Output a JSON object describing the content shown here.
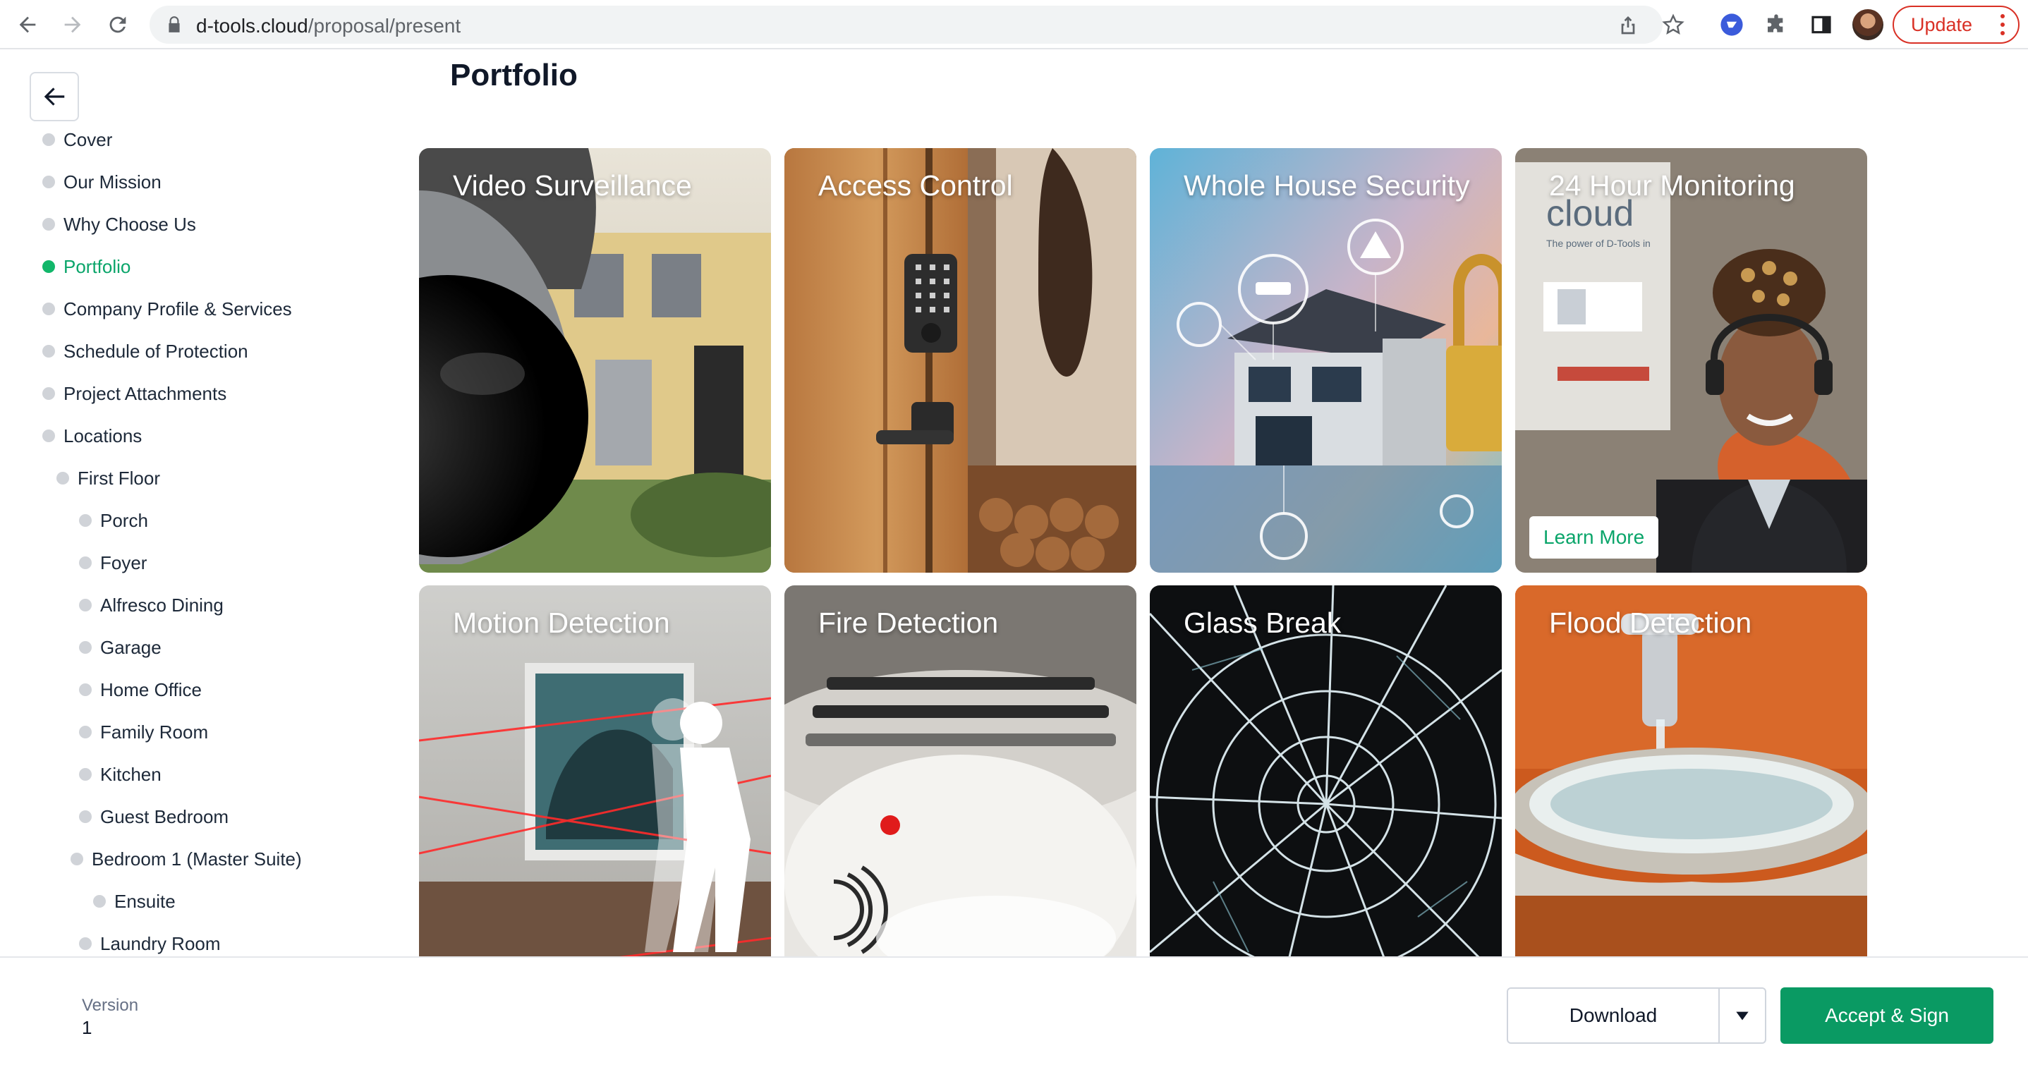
{
  "browser": {
    "url_host": "d-tools.cloud",
    "url_path": "/proposal/present",
    "update_label": "Update"
  },
  "page": {
    "title": "Portfolio"
  },
  "sidebar": {
    "items": [
      {
        "label": "Cover",
        "active": false
      },
      {
        "label": "Our Mission",
        "active": false
      },
      {
        "label": "Why Choose Us",
        "active": false
      },
      {
        "label": "Portfolio",
        "active": true
      },
      {
        "label": "Company Profile & Services",
        "active": false
      },
      {
        "label": "Schedule of Protection",
        "active": false
      },
      {
        "label": "Project Attachments",
        "active": false
      },
      {
        "label": "Locations",
        "active": false
      },
      {
        "label": "First Floor",
        "active": false
      },
      {
        "label": "Porch",
        "active": false
      },
      {
        "label": "Foyer",
        "active": false
      },
      {
        "label": "Alfresco Dining",
        "active": false
      },
      {
        "label": "Garage",
        "active": false
      },
      {
        "label": "Home Office",
        "active": false
      },
      {
        "label": "Family Room",
        "active": false
      },
      {
        "label": "Kitchen",
        "active": false
      },
      {
        "label": "Guest Bedroom",
        "active": false
      },
      {
        "label": "Bedroom 1 (Master Suite)",
        "active": false
      },
      {
        "label": "Ensuite",
        "active": false
      },
      {
        "label": "Laundry Room",
        "active": false
      }
    ]
  },
  "portfolio": {
    "tiles": [
      {
        "title": "Video Surveillance"
      },
      {
        "title": "Access Control"
      },
      {
        "title": "Whole House Security"
      },
      {
        "title": "24 Hour Monitoring",
        "button": "Learn More"
      },
      {
        "title": "Motion Detection"
      },
      {
        "title": "Fire Detection"
      },
      {
        "title": "Glass Break"
      },
      {
        "title": "Flood Detection"
      }
    ],
    "tile_photo_text": {
      "brand": "cloud",
      "tagline": "The power of D-Tools in an easy-to-use, web-based solution."
    }
  },
  "footer": {
    "version_label": "Version",
    "version_value": "1",
    "download_label": "Download",
    "accept_label": "Accept & Sign"
  },
  "colors": {
    "accent": "#12b76a",
    "primary_button": "#0a9a63",
    "update": "#d93025"
  }
}
